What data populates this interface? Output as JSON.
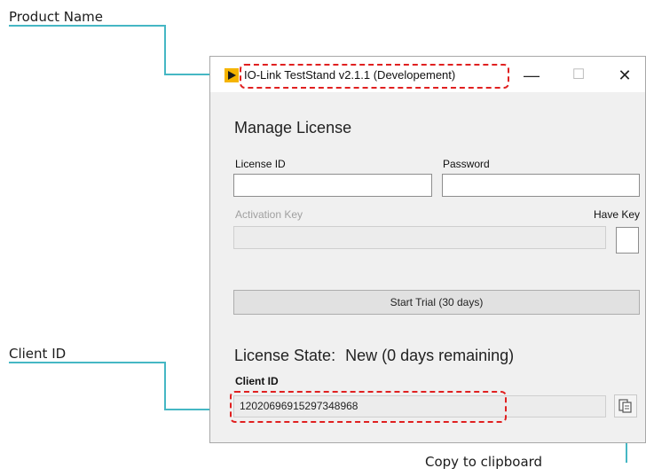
{
  "callouts": {
    "product_name": "Product Name",
    "client_id": "Client ID",
    "copy_to_clipboard": "Copy to clipboard"
  },
  "window": {
    "title": "IO-Link TestStand v2.1.1 (Developement)",
    "controls": {
      "minimize": "—",
      "maximize": "☐",
      "close": "✕"
    }
  },
  "license": {
    "section_title": "Manage License",
    "license_id_label": "License ID",
    "license_id_value": "",
    "password_label": "Password",
    "password_value": "",
    "activation_key_label": "Activation Key",
    "activation_key_value": "",
    "have_key_label": "Have Key",
    "start_trial_label": "Start Trial (30 days)",
    "state_label": "License State:",
    "state_value": "New (0 days remaining)",
    "client_id_label": "Client ID",
    "client_id_value": "12020696915297348968"
  },
  "colors": {
    "callout_line": "#45b7c4",
    "highlight_dash": "#e02020",
    "app_icon": "#f5b400"
  },
  "icons": {
    "app": "labview-arrow-icon",
    "copy": "copy-icon"
  }
}
